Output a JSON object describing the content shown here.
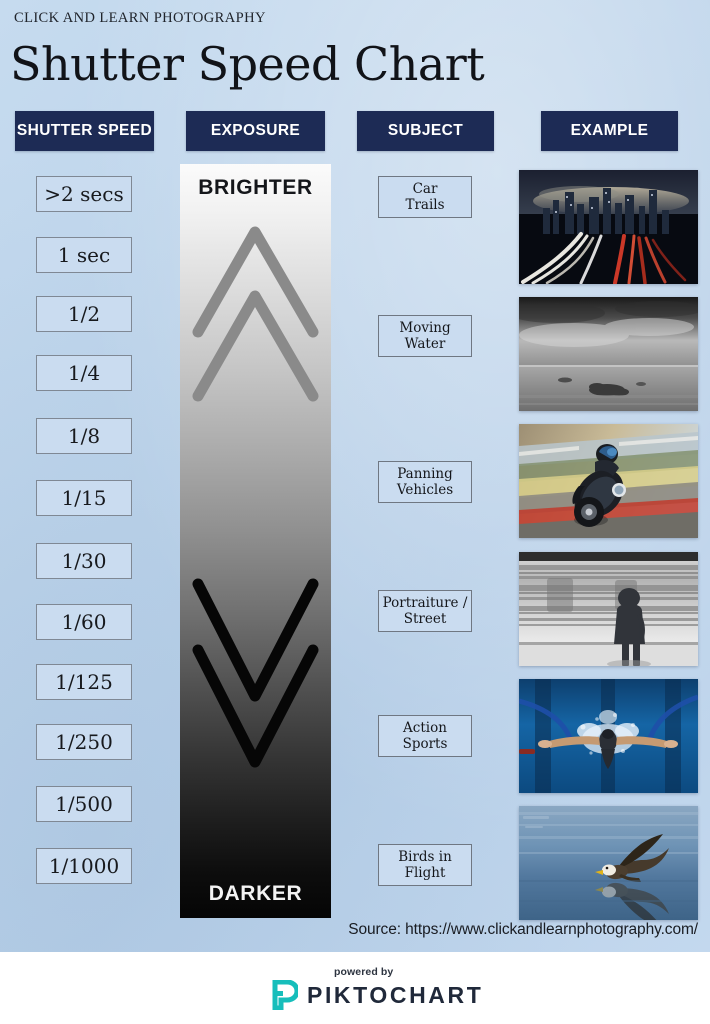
{
  "header": {
    "kicker": "CLICK AND LEARN PHOTOGRAPHY",
    "title": "Shutter Speed Chart"
  },
  "columns": {
    "shutter_speed": "SHUTTER SPEED",
    "exposure": "EXPOSURE",
    "subject": "SUBJECT",
    "example": "EXAMPLE"
  },
  "shutter_speeds": [
    "&gt;2 secs",
    "1 sec",
    "1/2",
    "1/4",
    "1/8",
    "1/15",
    "1/30",
    "1/60",
    "1/125",
    "1/250",
    "1/500",
    "1/1000"
  ],
  "exposure": {
    "top_label": "BRIGHTER",
    "bottom_label": "DARKER",
    "up_chevron_icon": "chevron-double-up-icon",
    "down_chevron_icon": "chevron-double-down-icon",
    "gradient_from": "#fbfbfb",
    "gradient_to": "#050505"
  },
  "subjects": [
    {
      "line1": "Car",
      "line2": "Trails"
    },
    {
      "line1": "Moving",
      "line2": "Water"
    },
    {
      "line1": "Panning",
      "line2": "Vehicles"
    },
    {
      "line1": "Portraiture /",
      "line2": "Street"
    },
    {
      "line1": "Action",
      "line2": "Sports"
    },
    {
      "line1": "Birds in",
      "line2": "Flight"
    }
  ],
  "examples": [
    {
      "alt": "city-night-light-trails-photo"
    },
    {
      "alt": "long-exposure-seascape-photo"
    },
    {
      "alt": "panning-motorcycle-racer-photo"
    },
    {
      "alt": "motion-blur-train-platform-photo"
    },
    {
      "alt": "swimmer-butterfly-stroke-photo"
    },
    {
      "alt": "eagle-in-flight-over-water-photo"
    }
  ],
  "source": {
    "text": "Source: https://www.clickandlearnphotography.com/"
  },
  "footer": {
    "powered_by": "powered by",
    "brand": "PIKTOCHART",
    "logo_icon": "piktochart-logo-icon",
    "accent_color": "#17bebb",
    "brand_color": "#20293a"
  },
  "theme": {
    "background": "#bcd3ea",
    "header_chip": "#1d2b55",
    "chip_fill": "#cadcf0"
  }
}
